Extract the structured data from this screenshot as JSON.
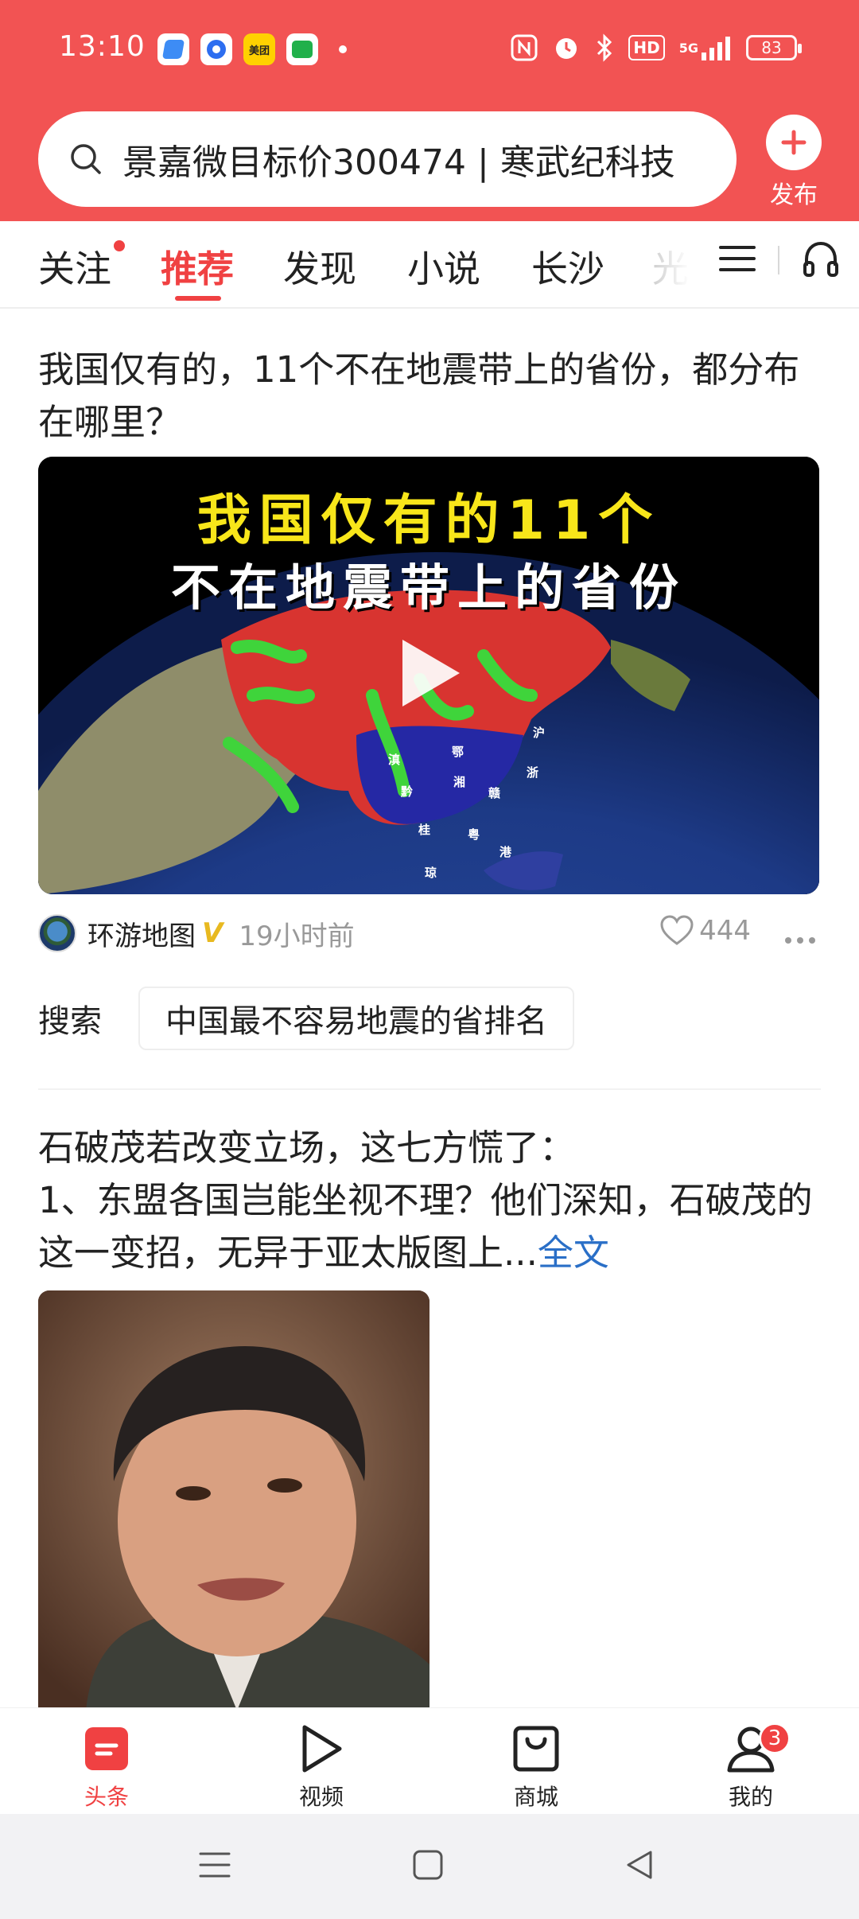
{
  "status_bar": {
    "time": "13:10",
    "app_icons": [
      "blue-notes-app",
      "blue-circle-app",
      "美团",
      "green-chat-app"
    ],
    "sys_icons": [
      "nfc-icon",
      "alarm-icon",
      "bluetooth-icon",
      "hd-icon",
      "5g-signal-icon"
    ],
    "signal_label": "5G",
    "hd_label": "HD",
    "battery": "83"
  },
  "search": {
    "query": "景嘉微目标价300474 | 寒武纪科技"
  },
  "publish": {
    "label": "发布"
  },
  "tabs": [
    {
      "label": "关注",
      "active": false,
      "dot": true
    },
    {
      "label": "推荐",
      "active": true
    },
    {
      "label": "发现",
      "active": false
    },
    {
      "label": "小说",
      "active": false
    },
    {
      "label": "长沙",
      "active": false
    },
    {
      "label": "光",
      "active": false
    }
  ],
  "feed": {
    "article1": {
      "title": "我国仅有的，11个不在地震带上的省份，都分布在哪里？",
      "video_headline_1": "我国仅有的11个",
      "video_headline_2": "不在地震带上的省份",
      "map_labels": [
        "滇",
        "鄂",
        "黔",
        "湘",
        "赣",
        "浙",
        "桂",
        "粤",
        "港",
        "琼",
        "沪"
      ],
      "author": "环游地图",
      "verified_mark": "V",
      "time": "19小时前",
      "likes": "444"
    },
    "search_suggestion": {
      "label": "搜索",
      "query": "中国最不容易地震的省排名"
    },
    "article2": {
      "line1": "石破茂若改变立场，这七方慌了：",
      "line2": "1、东盟各国岂能坐视不理？他们深知，石破茂的这一变招，无异于亚太版图上...",
      "read_more": "全文"
    }
  },
  "bottom_nav": [
    {
      "label": "头条",
      "icon": "toutiao-icon",
      "active": true
    },
    {
      "label": "视频",
      "icon": "video-play-icon",
      "active": false
    },
    {
      "label": "商城",
      "icon": "shopping-bag-icon",
      "active": false
    },
    {
      "label": "我的",
      "icon": "user-icon",
      "active": false,
      "badge": "3"
    }
  ],
  "colors": {
    "brand_red": "#f04142",
    "header_red": "#f25353",
    "link_blue": "#2a6fc7",
    "verified_gold": "#e8b920"
  }
}
